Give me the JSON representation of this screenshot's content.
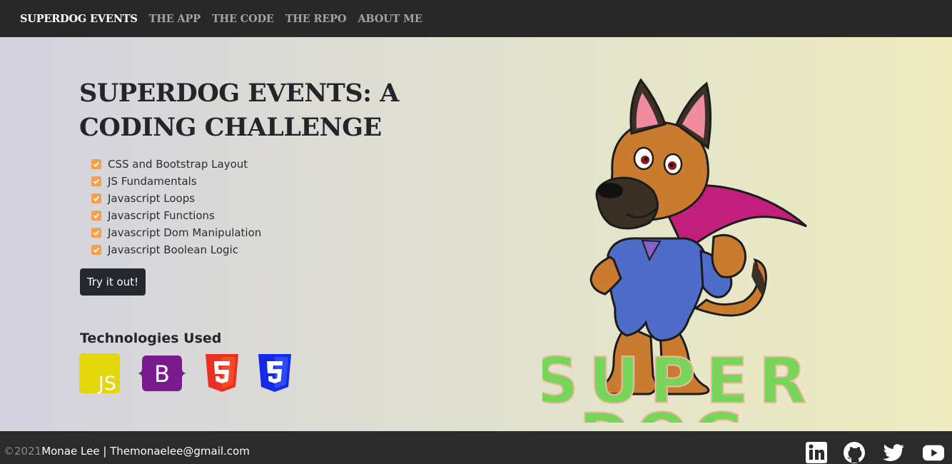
{
  "nav": {
    "brand": "SUPERDOG EVENTS",
    "links": [
      "THE APP",
      "THE CODE",
      "THE REPO",
      "ABOUT ME"
    ]
  },
  "hero": {
    "title": "SUPERDOG EVENTS: A CODING CHALLENGE",
    "features": [
      "CSS and Bootstrap Layout",
      "JS Fundamentals",
      "Javascript Loops",
      "Javascript Functions",
      "Javascript Dom Manipulation",
      "Javascript Boolean Logic"
    ],
    "cta_label": "Try it out!",
    "tech_heading": "Technologies Used",
    "tech_icons": [
      "js-icon",
      "bootstrap-icon",
      "html5-icon",
      "css3-icon"
    ],
    "logo_text_line1": "SUPER",
    "logo_text_line2": "DOG"
  },
  "footer": {
    "copyright": "©2021",
    "author": "Monae Lee | Themonaelee@gmail.com",
    "social_icons": [
      "linkedin-icon",
      "github-icon",
      "twitter-icon",
      "youtube-icon"
    ]
  },
  "colors": {
    "navbar_bg": "#282828",
    "check_orange": "#f5a04a",
    "button_dark": "#24272d",
    "logo_green": "#77d65a",
    "cape_magenta": "#c21f7d"
  }
}
